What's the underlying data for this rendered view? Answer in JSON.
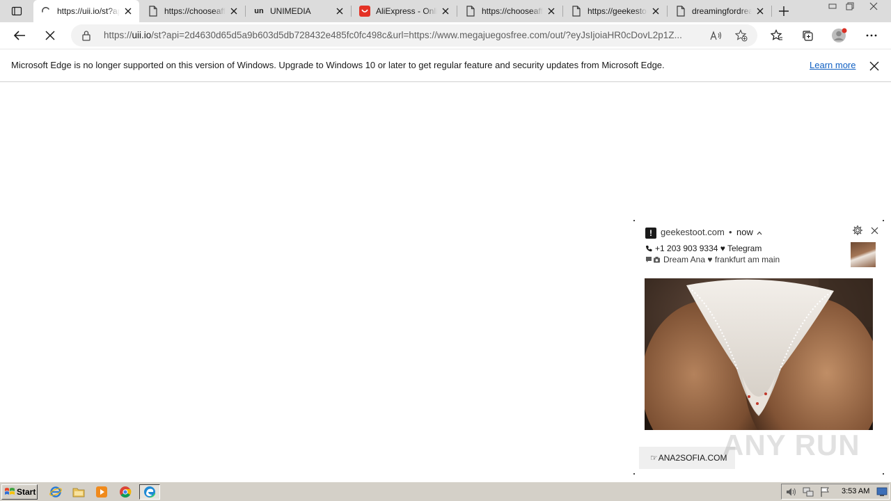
{
  "browser": {
    "tabs": [
      {
        "title": "https://uii.io/st?api=2d4630d65d5a9b603d5db",
        "icon": "loading-spinner-icon",
        "active": true
      },
      {
        "title": "https://chooseaffordable",
        "icon": "page-icon",
        "active": false
      },
      {
        "title": "UNIMEDIA",
        "icon": "unimedia-icon",
        "icon_text": "un",
        "active": false
      },
      {
        "title": "AliExpress - Online Shopping",
        "icon": "aliexpress-icon",
        "active": false
      },
      {
        "title": "https://chooseaffordable",
        "icon": "page-icon",
        "active": false
      },
      {
        "title": "https://geekestoot.com",
        "icon": "page-icon",
        "active": false
      },
      {
        "title": "dreamingfordreams",
        "icon": "page-icon",
        "active": false
      }
    ],
    "address": {
      "prefix": "https://",
      "host": "uii.io",
      "rest": "/st?api=2d4630d65d5a9b603d5db728432e485fc0fc498c&url=https://www.megajuegosfree.com/out/?eyJsIjoiaHR0cDovL2p1Z..."
    },
    "infobar": {
      "message": "Microsoft Edge is no longer supported on this version of Windows. Upgrade to Windows 10 or later to get regular feature and security updates from Microsoft Edge.",
      "link": "Learn more"
    }
  },
  "notification": {
    "site": "geekestoot.com",
    "separator": "•",
    "time": "now",
    "line1": "+1 203 903 9334 ♥ Telegram",
    "line2": "Dream Ana ♥ frankfurt am main",
    "cta": "ANA2SOFIA.COM"
  },
  "watermark": {
    "text": "ANY RUN"
  },
  "taskbar": {
    "start_label": "Start",
    "clock": "3:53 AM"
  },
  "colors": {
    "link": "#0f5fc2",
    "tabstrip": "#dcdcdc",
    "taskbar": "#d4d0c8",
    "aliexpress": "#e43225"
  }
}
